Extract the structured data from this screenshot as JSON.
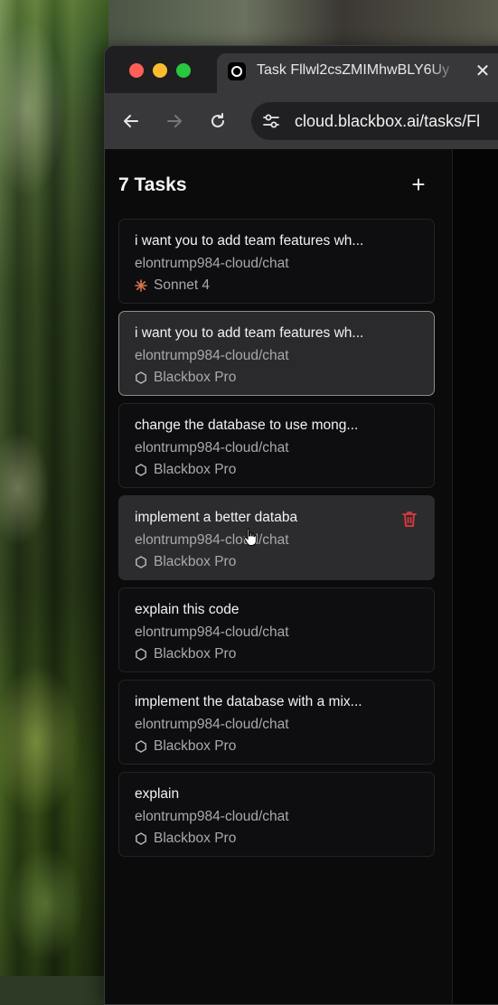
{
  "browser": {
    "tab_title": "Task Fllwl2csZMIMhwBLY6Uy",
    "tab_close": "✕",
    "url": "cloud.blackbox.ai/tasks/Fl",
    "icons": [
      "back-arrow-icon",
      "forward-arrow-icon",
      "reload-icon",
      "site-settings-icon"
    ]
  },
  "sidebar": {
    "header": "7 Tasks",
    "add_label": "+",
    "tasks": [
      {
        "title": "i want you to add team features wh...",
        "repo": "elontrump984-cloud/chat",
        "model": "Sonnet 4",
        "model_icon": "claude-spark-icon",
        "state": "normal"
      },
      {
        "title": "i want you to add team features wh...",
        "repo": "elontrump984-cloud/chat",
        "model": "Blackbox Pro",
        "model_icon": "hexagon-icon",
        "state": "selected"
      },
      {
        "title": "change the database to use mong...",
        "repo": "elontrump984-cloud/chat",
        "model": "Blackbox Pro",
        "model_icon": "hexagon-icon",
        "state": "normal"
      },
      {
        "title": "implement a better databa",
        "repo": "elontrump984-cloud/chat",
        "model": "Blackbox Pro",
        "model_icon": "hexagon-icon",
        "state": "hovered"
      },
      {
        "title": "explain this code",
        "repo": "elontrump984-cloud/chat",
        "model": "Blackbox Pro",
        "model_icon": "hexagon-icon",
        "state": "normal"
      },
      {
        "title": "implement the database with a mix...",
        "repo": "elontrump984-cloud/chat",
        "model": "Blackbox Pro",
        "model_icon": "hexagon-icon",
        "state": "normal"
      },
      {
        "title": "explain",
        "repo": "elontrump984-cloud/chat",
        "model": "Blackbox Pro",
        "model_icon": "hexagon-icon",
        "state": "normal"
      }
    ]
  },
  "colors": {
    "delete_icon": "#e0393e",
    "sonnet_icon": "#d9734a",
    "window_bg": "#0b0b0c",
    "card_selected_border": "#8d8d90"
  }
}
